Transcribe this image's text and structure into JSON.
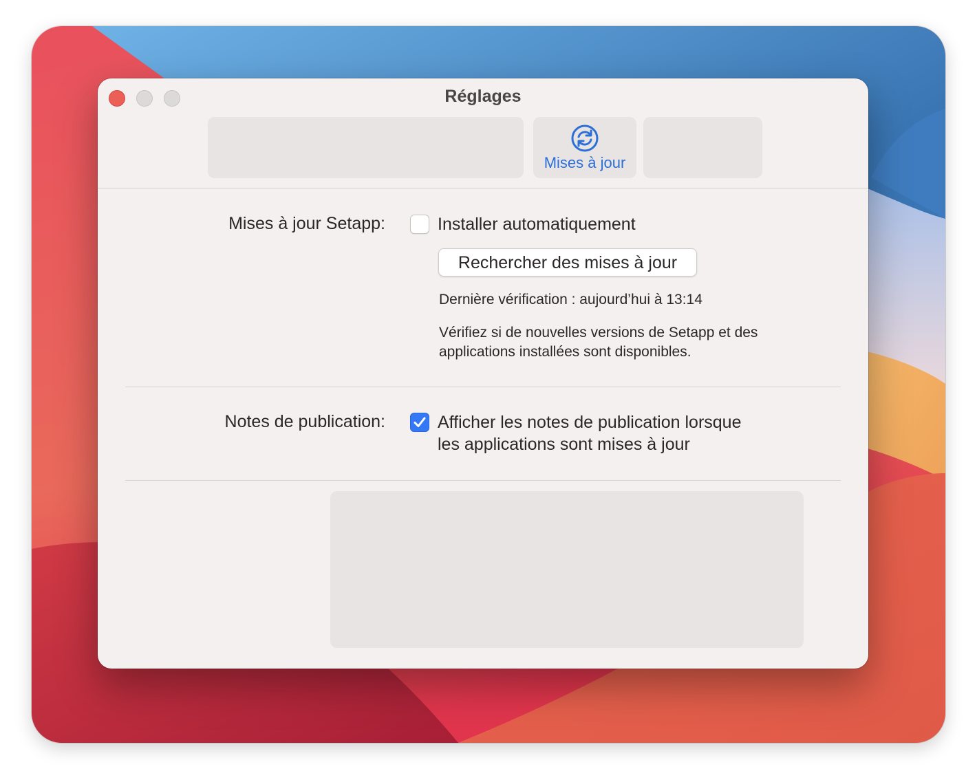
{
  "window": {
    "title": "Réglages"
  },
  "toolbar": {
    "active_tab": {
      "label": "Mises à jour",
      "icon": "refresh-icon",
      "color": "#2c6fd6"
    }
  },
  "setapp_updates": {
    "label": "Mises à jour Setapp:",
    "auto_install": {
      "label": "Installer automatiquement",
      "checked": false
    },
    "check_button_label": "Rechercher des mises à jour",
    "last_check": "Dernière vérification : aujourd’hui à 13:14",
    "description_line1": "Vérifiez si de nouvelles versions de Setapp et des",
    "description_line2": "applications installées sont disponibles."
  },
  "release_notes": {
    "label": "Notes de publication:",
    "show_notes": {
      "label_line1": "Afficher les notes de publication lorsque",
      "label_line2": "les applications sont mises à jour",
      "checked": true
    }
  },
  "colors": {
    "accent": "#3478f6",
    "close": "#ec5f57"
  }
}
